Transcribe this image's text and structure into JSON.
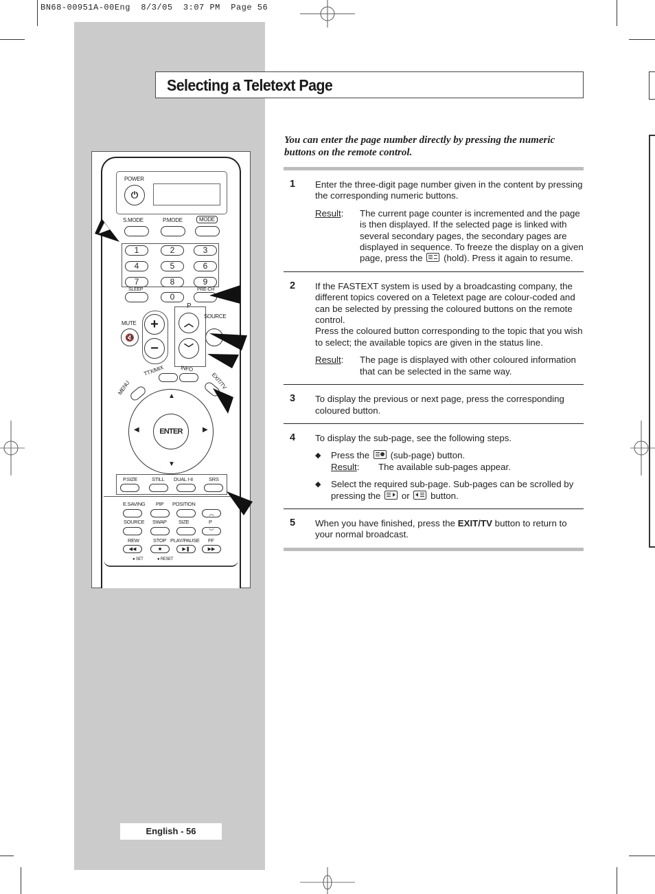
{
  "print_header": "BN68-00951A-00Eng  8/3/05  3:07 PM  Page 56",
  "page_title": "Selecting a Teletext Page",
  "intro": "You can enter the page number directly by pressing the numeric buttons on the remote control.",
  "result_label": "Result",
  "steps": [
    {
      "number": "1",
      "text": "Enter the three-digit page number given in the content by pressing the corresponding numeric buttons.",
      "result_before_icon": "The current page counter is incremented and the page is then displayed. If the selected page is linked with several secondary pages, the secondary pages are displayed in sequence. To freeze the display on a given page, press the",
      "result_after_icon": "(hold). Press it again to resume.",
      "icon": "hold-icon"
    },
    {
      "number": "2",
      "text_1": "If the FASTEXT system is used by a broadcasting company, the different topics covered on a Teletext page are colour-coded and can be selected by pressing the coloured buttons on the remote control.",
      "text_2": "Press the coloured button corresponding to the topic that you wish to select; the available topics are given in the status line.",
      "result": "The page is displayed with other coloured information that can be selected in the same way."
    },
    {
      "number": "3",
      "text": "To display the previous or next page, press the corresponding coloured button."
    },
    {
      "number": "4",
      "text": "To display the sub-page, see the following steps.",
      "bullet_1_before": "Press the",
      "bullet_1_after": "(sub-page) button.",
      "bullet_1_result": "The available sub-pages appear.",
      "bullet_2_before": "Select the required sub-page. Sub-pages can be scrolled by pressing the",
      "bullet_2_middle": "or",
      "bullet_2_after": "button."
    },
    {
      "number": "5",
      "text_before": "When you have finished, press the",
      "text_bold": "EXIT/TV",
      "text_after": "button to return to your normal broadcast."
    }
  ],
  "footer": "English - 56",
  "remote": {
    "power": "POWER",
    "smode": "S.MODE",
    "pmode": "P.MODE",
    "mode": "MODE",
    "digits": [
      "1",
      "2",
      "3",
      "4",
      "5",
      "6",
      "7",
      "8",
      "9"
    ],
    "zero": "0",
    "sleep": "SLEEP",
    "prech": "PRE-CH",
    "p": "P",
    "mute": "MUTE",
    "source": "SOURCE",
    "ttx": "TTX/MIX",
    "info": "INFO",
    "menu": "MENU",
    "exit": "EXIT/TV",
    "enter": "ENTER",
    "psize": "P.SIZE",
    "still": "STILL",
    "dual": "DUAL I-II",
    "srs": "SRS",
    "esaving": "E.SAVING",
    "pip": "PIP",
    "position": "POSITION",
    "source2": "SOURCE",
    "swap": "SWAP",
    "size": "SIZE",
    "p2": "P",
    "rew": "REW",
    "stop": "STOP",
    "playpause": "PLAY/PAUSE",
    "ff": "FF",
    "set": "SET",
    "reset": "RESET"
  }
}
